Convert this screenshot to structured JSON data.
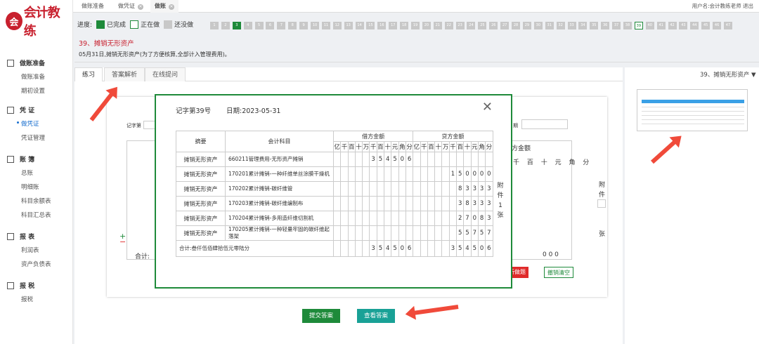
{
  "logo": {
    "text": "会计教练"
  },
  "sidebar": [
    {
      "title": "做账准备",
      "icon": "doc-icon",
      "items": [
        "做账准备",
        "期初设置"
      ]
    },
    {
      "title": "凭 证",
      "icon": "list-icon",
      "items": [
        "做凭证",
        "凭证管理"
      ]
    },
    {
      "title": "账 簿",
      "icon": "book-icon",
      "items": [
        "总账",
        "明细账",
        "科目余额表",
        "科目汇总表"
      ]
    },
    {
      "title": "报 表",
      "icon": "layers-icon",
      "items": [
        "利润表",
        "资产负债表"
      ]
    },
    {
      "title": "报 税",
      "icon": "layers-icon",
      "items": [
        "报税"
      ]
    }
  ],
  "topbar": {
    "tabs": [
      "做账准备",
      "做凭证",
      "做账"
    ],
    "user": "用户名:会计教练老师",
    "logout": "退出"
  },
  "progress": {
    "label": "进度:",
    "done": "已完成",
    "doing": "正在做",
    "todo": "还没做",
    "current": 39,
    "total": 47
  },
  "question": {
    "title": "39、摊销无形资产",
    "desc": "05月31日,摊销无形资产(为了方便核算,全部计入管理费用)。"
  },
  "tabs2": [
    "练习",
    "答案解析",
    "在线提问"
  ],
  "qselect": "39、摊销无形资产 ▼",
  "bg": {
    "voucher_label": "记字第",
    "date_label": "期",
    "lender": "方金额",
    "attach": "附",
    "piece": "件",
    "zhang": "张",
    "total": "合计:",
    "zeros": "0  0  0",
    "reset": "新做题",
    "clear": "撤销清空",
    "cols": "千 百 十 元 角 分"
  },
  "modal": {
    "voucher_no": "记字第39号",
    "date": "日期:2023-05-31",
    "close": "✕",
    "head_summary": "摘要",
    "head_account": "会计科目",
    "head_debit": "借方金额",
    "head_credit": "贷方金额",
    "units": [
      "亿",
      "千",
      "百",
      "十",
      "万",
      "千",
      "百",
      "十",
      "元",
      "角",
      "分"
    ],
    "rows": [
      {
        "summary": "摊销无形资产",
        "account": "660211管理费用-无形资产摊销",
        "debit": [
          "",
          "",
          "",
          "",
          "",
          "3",
          "5",
          "4",
          "5",
          "0",
          "6"
        ],
        "credit": [
          "",
          "",
          "",
          "",
          "",
          "",
          "",
          "",
          "",
          "",
          ""
        ]
      },
      {
        "summary": "摊销无形资产",
        "account": "170201累计摊销-一种纤维单丝涂膜干燥机",
        "debit": [
          "",
          "",
          "",
          "",
          "",
          "",
          "",
          "",
          "",
          "",
          ""
        ],
        "credit": [
          "",
          "",
          "",
          "",
          "",
          "1",
          "5",
          "0",
          "0",
          "0",
          "0"
        ]
      },
      {
        "summary": "摊销无形资产",
        "account": "170202累计摊销-碳纤维管",
        "debit": [
          "",
          "",
          "",
          "",
          "",
          "",
          "",
          "",
          "",
          "",
          ""
        ],
        "credit": [
          "",
          "",
          "",
          "",
          "",
          "",
          "8",
          "3",
          "3",
          "3",
          "3"
        ]
      },
      {
        "summary": "摊销无形资产",
        "account": "170203累计摊销-碳纤维编制布",
        "debit": [
          "",
          "",
          "",
          "",
          "",
          "",
          "",
          "",
          "",
          "",
          ""
        ],
        "credit": [
          "",
          "",
          "",
          "",
          "",
          "",
          "3",
          "8",
          "3",
          "3",
          "3"
        ]
      },
      {
        "summary": "摊销无形资产",
        "account": "170204累计摊销-多用造纤维切割机",
        "debit": [
          "",
          "",
          "",
          "",
          "",
          "",
          "",
          "",
          "",
          "",
          ""
        ],
        "credit": [
          "",
          "",
          "",
          "",
          "",
          "",
          "2",
          "7",
          "0",
          "8",
          "3"
        ]
      },
      {
        "summary": "摊销无形资产",
        "account": "170205累计摊销-一种轻量牢固的碳纤维起落架",
        "debit": [
          "",
          "",
          "",
          "",
          "",
          "",
          "",
          "",
          "",
          "",
          ""
        ],
        "credit": [
          "",
          "",
          "",
          "",
          "",
          "",
          "5",
          "5",
          "7",
          "5",
          "7"
        ]
      }
    ],
    "total_label": "合计:叁仟伍佰肆拾伍元零陆分",
    "total_debit": [
      "",
      "",
      "",
      "",
      "",
      "3",
      "5",
      "4",
      "5",
      "0",
      "6"
    ],
    "total_credit": [
      "",
      "",
      "",
      "",
      "",
      "3",
      "5",
      "4",
      "5",
      "0",
      "6"
    ],
    "attach": [
      "附",
      "件",
      "1",
      "张"
    ]
  },
  "buttons": {
    "submit": "提交答案",
    "view": "查看答案"
  },
  "colors": {
    "brand": "#c8202e",
    "done": "#1e8a3a",
    "teal": "#19a196",
    "arrow": "#f04a3a"
  }
}
